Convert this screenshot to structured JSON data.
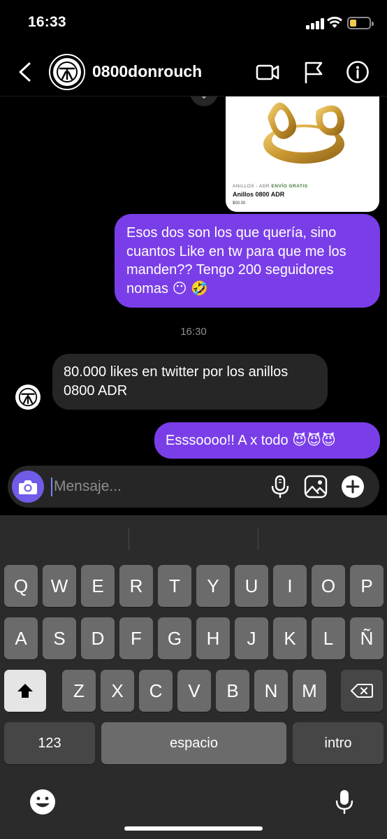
{
  "status_bar": {
    "time": "16:33"
  },
  "header": {
    "username": "0800donrouch"
  },
  "product": {
    "category": "ANILLOS - ADR",
    "shipping": "ENVÍO GRATIS",
    "name": "Anillos 0800 ADR",
    "price_partial": "$00.00"
  },
  "messages": [
    {
      "direction": "outgoing",
      "text": "Esos dos son los que quería, sino cuantos Like en tw para que me los manden?? Tengo 200 seguidores nomas 😶 🤣"
    },
    {
      "direction": "incoming",
      "text": "80.000 likes en twitter por los anillos 0800 ADR"
    },
    {
      "direction": "outgoing",
      "text": "Esssoooo!! A x todo 😈😈😈"
    }
  ],
  "timestamp": "16:30",
  "composer": {
    "placeholder": "Mensaje..."
  },
  "keyboard": {
    "row1": [
      "Q",
      "W",
      "E",
      "R",
      "T",
      "Y",
      "U",
      "I",
      "O",
      "P"
    ],
    "row2": [
      "A",
      "S",
      "D",
      "F",
      "G",
      "H",
      "J",
      "K",
      "L",
      "Ñ"
    ],
    "row3": [
      "Z",
      "X",
      "C",
      "V",
      "B",
      "N",
      "M"
    ],
    "numbers_key": "123",
    "space_key": "espacio",
    "return_key": "intro"
  },
  "icons": {
    "back": "chevron-left-icon",
    "video": "video-call-icon",
    "flag": "flag-icon",
    "info": "info-icon",
    "camera": "camera-icon",
    "mic": "microphone-icon",
    "gallery": "gallery-icon",
    "add": "plus-icon",
    "shift": "shift-icon",
    "delete": "backspace-icon",
    "emoji": "emoji-icon",
    "dictation": "dictation-icon"
  },
  "colors": {
    "outgoing_bubble": "#7a3ee8",
    "incoming_bubble": "#262626",
    "camera_button": "#6f5ce8"
  }
}
